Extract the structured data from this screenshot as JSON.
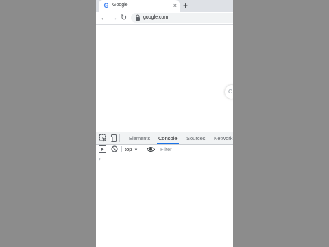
{
  "browser": {
    "tab": {
      "favicon": "G",
      "title": "Google",
      "close_glyph": "×"
    },
    "new_tab_glyph": "+",
    "toolbar": {
      "back_glyph": "←",
      "forward_glyph": "→",
      "reload_glyph": "↻",
      "url": "google.com"
    }
  },
  "page": {
    "side_bubble_glyph": "C"
  },
  "devtools": {
    "tabs": [
      {
        "label": "Elements",
        "active": false
      },
      {
        "label": "Console",
        "active": true
      },
      {
        "label": "Sources",
        "active": false
      },
      {
        "label": "Network",
        "active": false
      }
    ],
    "console_toolbar": {
      "context": "top",
      "context_caret": "▼",
      "filter_placeholder": "Filter"
    },
    "prompt_glyph": "›"
  },
  "colors": {
    "active_tab_underline": "#1a73e8",
    "backdrop": "#8c8c8c",
    "tab_strip": "#dee1e6"
  },
  "icons": [
    "google-favicon-icon",
    "close-icon",
    "plus-icon",
    "back-arrow-icon",
    "forward-arrow-icon",
    "reload-icon",
    "lock-icon",
    "inspect-element-icon",
    "device-toggle-icon",
    "sidebar-toggle-icon",
    "clear-console-icon",
    "eye-icon"
  ]
}
